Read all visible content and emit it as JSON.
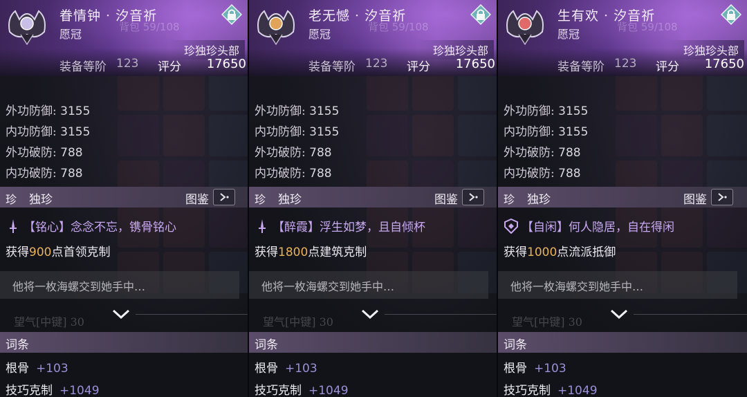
{
  "cards": [
    {
      "name": "眷情钟 · 汐音祈",
      "type": "愿冠",
      "bag_label": "背包 59/108",
      "rarity_tag": "珍独珍头部",
      "level_label": "装备等阶",
      "level_value": "123",
      "score_label": "评分",
      "score_value": "17650",
      "accent": "#c9bfe6",
      "stats": [
        {
          "label": "外功防御:",
          "value": "3155"
        },
        {
          "label": "内功防御:",
          "value": "3155"
        },
        {
          "label": "外功破防:",
          "value": "788"
        },
        {
          "label": "内功破防:",
          "value": "788"
        }
      ],
      "unique_mark": "珍",
      "unique_title": "独珍",
      "atlas_label": "图鉴",
      "effect_icon": "dagger-icon",
      "effect_text": "【铭心】念念不忘，镌骨铭心",
      "gain_prefix": "获得",
      "gain_value": "900",
      "gain_suffix": "点首领克制",
      "lore": "他将一枚海螺交到她手中…",
      "ghost": "望气[中键]  30",
      "terms_title": "词条",
      "attrs": [
        {
          "label": "根骨",
          "value": "+103"
        },
        {
          "label": "技巧克制",
          "value": "+1049"
        }
      ]
    },
    {
      "name": "老无憾 · 汐音祈",
      "type": "愿冠",
      "bag_label": "背包 59/108",
      "rarity_tag": "珍独珍头部",
      "level_label": "装备等阶",
      "level_value": "123",
      "score_label": "评分",
      "score_value": "17650",
      "accent": "#e0a35a",
      "stats": [
        {
          "label": "外功防御:",
          "value": "3155"
        },
        {
          "label": "内功防御:",
          "value": "3155"
        },
        {
          "label": "外功破防:",
          "value": "788"
        },
        {
          "label": "内功破防:",
          "value": "788"
        }
      ],
      "unique_mark": "珍",
      "unique_title": "独珍",
      "atlas_label": "图鉴",
      "effect_icon": "dagger-icon",
      "effect_text": "【醉霞】浮生如梦，且自倾杯",
      "gain_prefix": "获得",
      "gain_value": "1800",
      "gain_suffix": "点建筑克制",
      "lore": "他将一枚海螺交到她手中…",
      "ghost": "望气[中键]  30",
      "terms_title": "词条",
      "attrs": [
        {
          "label": "根骨",
          "value": "+103"
        },
        {
          "label": "技巧克制",
          "value": "+1049"
        }
      ]
    },
    {
      "name": "生有欢 · 汐音祈",
      "type": "愿冠",
      "bag_label": "背包 59/108",
      "rarity_tag": "珍独珍头部",
      "level_label": "装备等阶",
      "level_value": "123",
      "score_label": "评分",
      "score_value": "17650",
      "accent": "#e06a6a",
      "stats": [
        {
          "label": "外功防御:",
          "value": "3155"
        },
        {
          "label": "内功防御:",
          "value": "3155"
        },
        {
          "label": "外功破防:",
          "value": "788"
        },
        {
          "label": "内功破防:",
          "value": "788"
        }
      ],
      "unique_mark": "珍",
      "unique_title": "独珍",
      "atlas_label": "图鉴",
      "effect_icon": "shield-icon",
      "effect_text": "【自闲】何人隐居，自在得闲",
      "gain_prefix": "获得",
      "gain_value": "1000",
      "gain_suffix": "点流派抵御",
      "lore": "他将一枚海螺交到她手中…",
      "ghost": "望气[中键]  30",
      "terms_title": "词条",
      "attrs": [
        {
          "label": "根骨",
          "value": "+103"
        },
        {
          "label": "技巧克制",
          "value": "+1049"
        }
      ]
    }
  ]
}
